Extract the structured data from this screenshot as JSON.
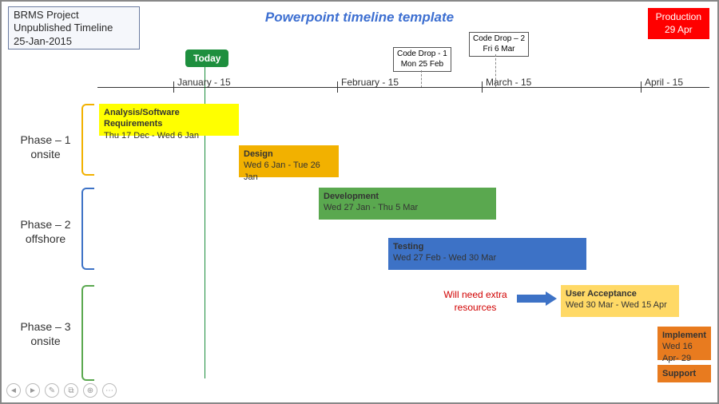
{
  "info": {
    "l1": "BRMS Project",
    "l2": "Unpublished Timeline",
    "l3": "25-Jan-2015"
  },
  "title": "Powerpoint timeline template",
  "production": {
    "l1": "Production",
    "l2": "29 Apr"
  },
  "today": "Today",
  "callouts": [
    {
      "l1": "Code Drop - 1",
      "l2": "Mon 25 Feb"
    },
    {
      "l1": "Code Drop – 2",
      "l2": "Fri 6 Mar"
    }
  ],
  "months": [
    "January - 15",
    "February - 15",
    "March - 15",
    "April - 15"
  ],
  "phases": [
    {
      "l1": "Phase – 1",
      "l2": "onsite"
    },
    {
      "l1": "Phase – 2",
      "l2": "offshore"
    },
    {
      "l1": "Phase – 3",
      "l2": "onsite"
    }
  ],
  "bars": {
    "analysis": {
      "t": "Analysis/Software Requirements",
      "d": "Thu 17 Dec - Wed 6 Jan"
    },
    "design": {
      "t": "Design",
      "d": "Wed 6 Jan - Tue 26 Jan"
    },
    "dev": {
      "t": "Development",
      "d": "Wed 27 Jan - Thu 5 Mar"
    },
    "testing": {
      "t": "Testing",
      "d": "Wed 27 Feb - Wed 30 Mar"
    },
    "ua": {
      "t": "User Acceptance",
      "d": "Wed 30 Mar - Wed 15 Apr"
    },
    "impl": {
      "t": "Implement",
      "d": "Wed 16 Apr- 29 Apr"
    },
    "support": {
      "t": "Support",
      "d": ""
    }
  },
  "note": {
    "l1": "Will need extra",
    "l2": "resources"
  },
  "chart_data": {
    "type": "gantt-timeline",
    "title": "Powerpoint timeline template",
    "project": "BRMS Project",
    "as_of": "25-Jan-2015",
    "x_axis": {
      "unit": "month",
      "ticks": [
        "January - 15",
        "February - 15",
        "March - 15",
        "April - 15"
      ]
    },
    "today": "25-Jan-2015",
    "milestones": [
      {
        "name": "Code Drop - 1",
        "date": "2015-02-25"
      },
      {
        "name": "Code Drop – 2",
        "date": "2015-03-06"
      },
      {
        "name": "Production",
        "date": "2015-04-29"
      }
    ],
    "phases": [
      {
        "name": "Phase – 1 onsite",
        "tasks": [
          "Analysis/Software Requirements",
          "Design"
        ]
      },
      {
        "name": "Phase – 2 offshore",
        "tasks": [
          "Development",
          "Testing"
        ]
      },
      {
        "name": "Phase – 3 onsite",
        "tasks": [
          "User Acceptance",
          "Implement",
          "Support"
        ]
      }
    ],
    "tasks": [
      {
        "name": "Analysis/Software Requirements",
        "start": "2014-12-17",
        "end": "2015-01-06",
        "color": "#ffff00"
      },
      {
        "name": "Design",
        "start": "2015-01-06",
        "end": "2015-01-26",
        "color": "#f2b100"
      },
      {
        "name": "Development",
        "start": "2015-01-27",
        "end": "2015-03-05",
        "color": "#5aa84f"
      },
      {
        "name": "Testing",
        "start": "2015-02-27",
        "end": "2015-03-30",
        "color": "#3d72c6"
      },
      {
        "name": "User Acceptance",
        "start": "2015-03-30",
        "end": "2015-04-15",
        "color": "#ffd966",
        "note": "Will need extra resources"
      },
      {
        "name": "Implement",
        "start": "2015-04-16",
        "end": "2015-04-29",
        "color": "#e87b1f"
      },
      {
        "name": "Support",
        "start": "2015-04-29",
        "end": null,
        "color": "#e87b1f"
      }
    ]
  }
}
